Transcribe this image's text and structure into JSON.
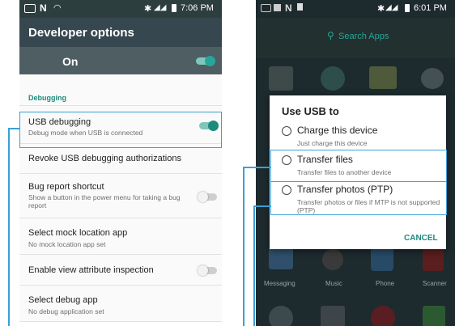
{
  "left_screen": {
    "status_time": "7:06 PM",
    "title": "Developer options",
    "master_toggle_label": "On",
    "section_header": "Debugging",
    "items": [
      {
        "title": "USB debugging",
        "subtitle": "Debug mode when USB is connected",
        "toggle": "on"
      },
      {
        "title": "Revoke USB debugging authorizations",
        "subtitle": ""
      },
      {
        "title": "Bug report shortcut",
        "subtitle": "Show a button in the power menu for taking a bug report",
        "toggle": "off"
      },
      {
        "title": "Select mock location app",
        "subtitle": "No mock location app set"
      },
      {
        "title": "Enable view attribute inspection",
        "subtitle": "",
        "toggle": "off"
      },
      {
        "title": "Select debug app",
        "subtitle": "No debug application set"
      }
    ]
  },
  "right_screen": {
    "status_time": "6:01 PM",
    "search_label": "Search Apps",
    "dialog": {
      "title": "Use USB to",
      "options": [
        {
          "title": "Charge this device",
          "subtitle": "Just charge this device"
        },
        {
          "title": "Transfer files",
          "subtitle": "Transfer files to another device"
        },
        {
          "title": "Transfer photos (PTP)",
          "subtitle": "Transfer photos or files if MTP is not supported (PTP)"
        }
      ],
      "cancel_label": "CANCEL"
    },
    "dock_apps": [
      "Messaging",
      "Music",
      "Phone",
      "Scanner"
    ]
  },
  "colors": {
    "accent": "#1e8a7c",
    "appbar": "#37474f",
    "callout": "#3aa0d8",
    "search": "#26a69a"
  }
}
